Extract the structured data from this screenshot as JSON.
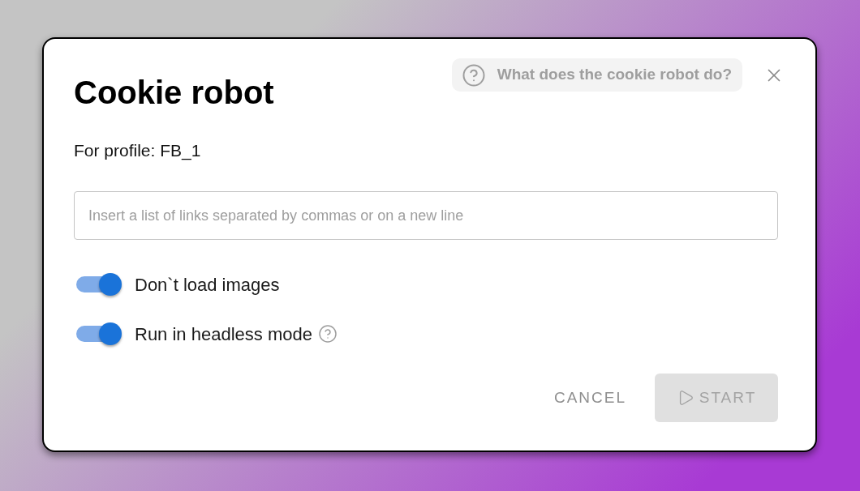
{
  "dialog": {
    "title": "Cookie robot",
    "help_link": "What does the cookie robot do?",
    "profile_label": "For profile: FB_1",
    "links_field": {
      "placeholder": "Insert a list of links separated by commas or on a new line"
    },
    "options": [
      {
        "label": "Don`t load images",
        "on": true,
        "help": false
      },
      {
        "label": "Run in headless mode",
        "on": true,
        "help": true
      }
    ],
    "buttons": [
      {
        "label": "CANCEL",
        "kind": "text",
        "disabled": false
      },
      {
        "label": "START",
        "kind": "primary",
        "disabled": true
      }
    ]
  }
}
